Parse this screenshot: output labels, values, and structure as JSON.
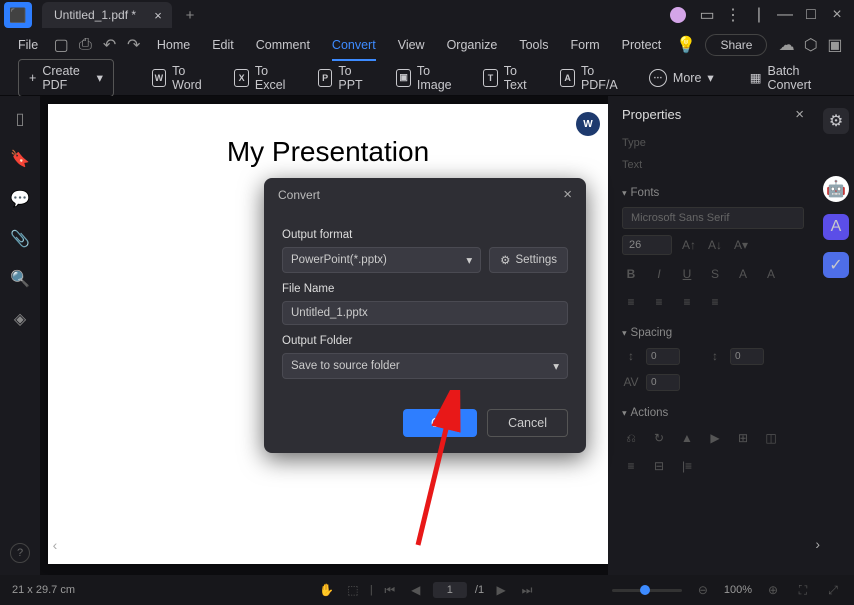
{
  "titlebar": {
    "tab_title": "Untitled_1.pdf *"
  },
  "menubar": {
    "file": "File",
    "items": [
      "Home",
      "Edit",
      "Comment",
      "Convert",
      "View",
      "Organize",
      "Tools",
      "Form",
      "Protect"
    ],
    "active_index": 3,
    "share": "Share"
  },
  "toolbar": {
    "create_pdf": "Create PDF",
    "to_word": "To Word",
    "to_excel": "To Excel",
    "to_ppt": "To PPT",
    "to_image": "To Image",
    "to_text": "To Text",
    "to_pdfa": "To PDF/A",
    "more": "More",
    "batch": "Batch Convert"
  },
  "document": {
    "title": "My Presentation"
  },
  "dialog": {
    "title": "Convert",
    "output_format_label": "Output format",
    "output_format_value": "PowerPoint(*.pptx)",
    "settings": "Settings",
    "file_name_label": "File Name",
    "file_name_value": "Untitled_1.pptx",
    "output_folder_label": "Output Folder",
    "output_folder_value": "Save to source folder",
    "ok": "OK",
    "cancel": "Cancel"
  },
  "properties": {
    "title": "Properties",
    "type_label": "Type",
    "text_label": "Text",
    "fonts_section": "Fonts",
    "font_name": "Microsoft Sans Serif",
    "font_size": "26",
    "spacing_section": "Spacing",
    "spacing_val": "0",
    "actions_section": "Actions"
  },
  "statusbar": {
    "dims": "21 x 29.7 cm",
    "page_current": "1",
    "page_total": "/1",
    "zoom": "100%"
  }
}
